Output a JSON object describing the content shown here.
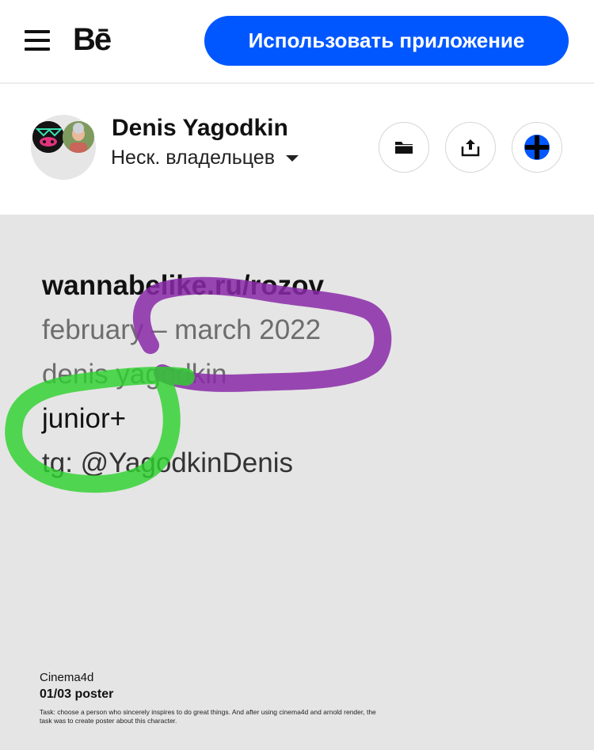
{
  "header": {
    "menu_icon": "hamburger-menu-icon",
    "logo": "Bē",
    "cta_label": "Использовать приложение",
    "cta_color": "#0057ff"
  },
  "owner": {
    "name": "Denis Yagodkin",
    "owners_label": "Неск. владельцев",
    "actions": [
      {
        "icon": "folder-icon"
      },
      {
        "icon": "share-icon"
      },
      {
        "icon": "add-icon"
      }
    ]
  },
  "poster": {
    "background": "#e5e5e5",
    "url": "wannabelike.ru/rozov",
    "dates": "february – march 2022",
    "author": "denis yagodkin",
    "level": "junior+",
    "telegram": "tg: @YagodkinDenis",
    "software": "Cinema4d",
    "part": "01/03 poster",
    "task": "Task: choose a person who sincerely inspires to do great things. And after using cinema4d and arnold render, the task was to create poster about this character.",
    "annotations": [
      {
        "shape": "purple-ellipse",
        "color": "#8a2aa8"
      },
      {
        "shape": "green-ellipse",
        "color": "#2ed12e"
      }
    ]
  }
}
